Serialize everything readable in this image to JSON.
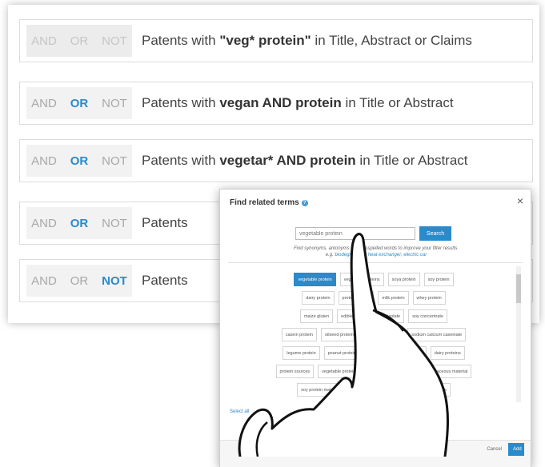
{
  "rows": [
    {
      "ops": [
        "AND",
        "OR",
        "NOT"
      ],
      "prefix": "Patents with ",
      "term": "\"veg* protein\"",
      "suffix": " in Title, Abstract or Claims"
    },
    {
      "ops": [
        "AND",
        "OR",
        "NOT"
      ],
      "prefix": "Patents with ",
      "term": "vegan AND protein",
      "suffix": " in Title or Abstract"
    },
    {
      "ops": [
        "AND",
        "OR",
        "NOT"
      ],
      "prefix": "Patents with ",
      "term": "vegetar* AND protein",
      "suffix": " in Title or Abstract"
    },
    {
      "ops": [
        "AND",
        "OR",
        "NOT"
      ],
      "prefix": "Patents",
      "term": "",
      "suffix": ""
    },
    {
      "ops": [
        "AND",
        "OR",
        "NOT"
      ],
      "prefix": "Patents",
      "term": "",
      "suffix": ""
    }
  ],
  "modal": {
    "title": "Find related terms",
    "info_icon": "?",
    "close": "×",
    "search_value": "vegetable protein",
    "search_button": "Search",
    "hint": "Find synonyms, antonyms and misspelled words to improve your filter results.",
    "hint_prefix": "e.g. ",
    "hint_links": "biodegradable, heat exchanger, electric car",
    "chips": [
      [
        "vegetable protein",
        "vegetable proteins",
        "soya protein",
        "soy protein"
      ],
      [
        "dairy protein",
        "protein source",
        "milk protein",
        "whey protein"
      ],
      [
        "maize gluten",
        "edible protein",
        "soy isolate",
        "soy concentrate"
      ],
      [
        "casein protein",
        "oilseed protein",
        "vital wheat gluten",
        "sodium calcium caseinate"
      ],
      [
        "legume protein",
        "peanut protein isolate",
        "wheat protein isolate",
        "dairy proteins"
      ],
      [
        "protein sources",
        "vegetable protein source",
        "legume protein",
        "proteinaceous material"
      ],
      [
        "soy protein material",
        "non-casein protein",
        "animal protein materials"
      ]
    ],
    "select_all": "Select all",
    "cancel": "Cancel",
    "add": "Add"
  },
  "colors": {
    "accent": "#2b8ac9"
  }
}
